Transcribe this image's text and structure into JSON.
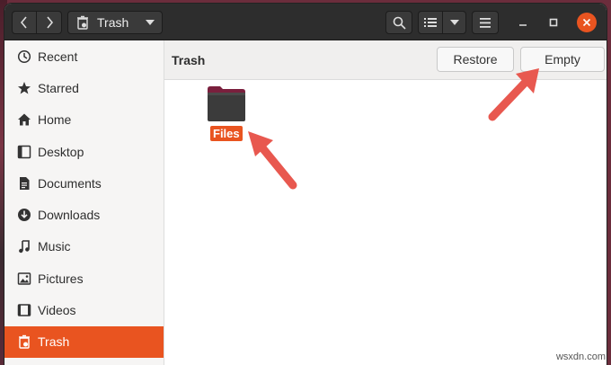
{
  "headerbar": {
    "location": "Trash",
    "back_icon": "chevron-left-icon",
    "forward_icon": "chevron-right-icon"
  },
  "sidebar": {
    "items": [
      {
        "label": "Recent",
        "icon": "clock-icon"
      },
      {
        "label": "Starred",
        "icon": "star-icon"
      },
      {
        "label": "Home",
        "icon": "home-icon"
      },
      {
        "label": "Desktop",
        "icon": "desktop-icon"
      },
      {
        "label": "Documents",
        "icon": "document-icon"
      },
      {
        "label": "Downloads",
        "icon": "download-icon"
      },
      {
        "label": "Music",
        "icon": "music-icon"
      },
      {
        "label": "Pictures",
        "icon": "picture-icon"
      },
      {
        "label": "Videos",
        "icon": "video-icon"
      },
      {
        "label": "Trash",
        "icon": "trash-icon",
        "active": true
      }
    ]
  },
  "main": {
    "title": "Trash",
    "restore_label": "Restore",
    "empty_label": "Empty",
    "files": [
      {
        "name": "Files"
      }
    ]
  },
  "watermark": "wsxdn.com",
  "colors": {
    "accent": "#e95420",
    "headerbar": "#2d2d2d",
    "arrow": "#e8584f"
  }
}
